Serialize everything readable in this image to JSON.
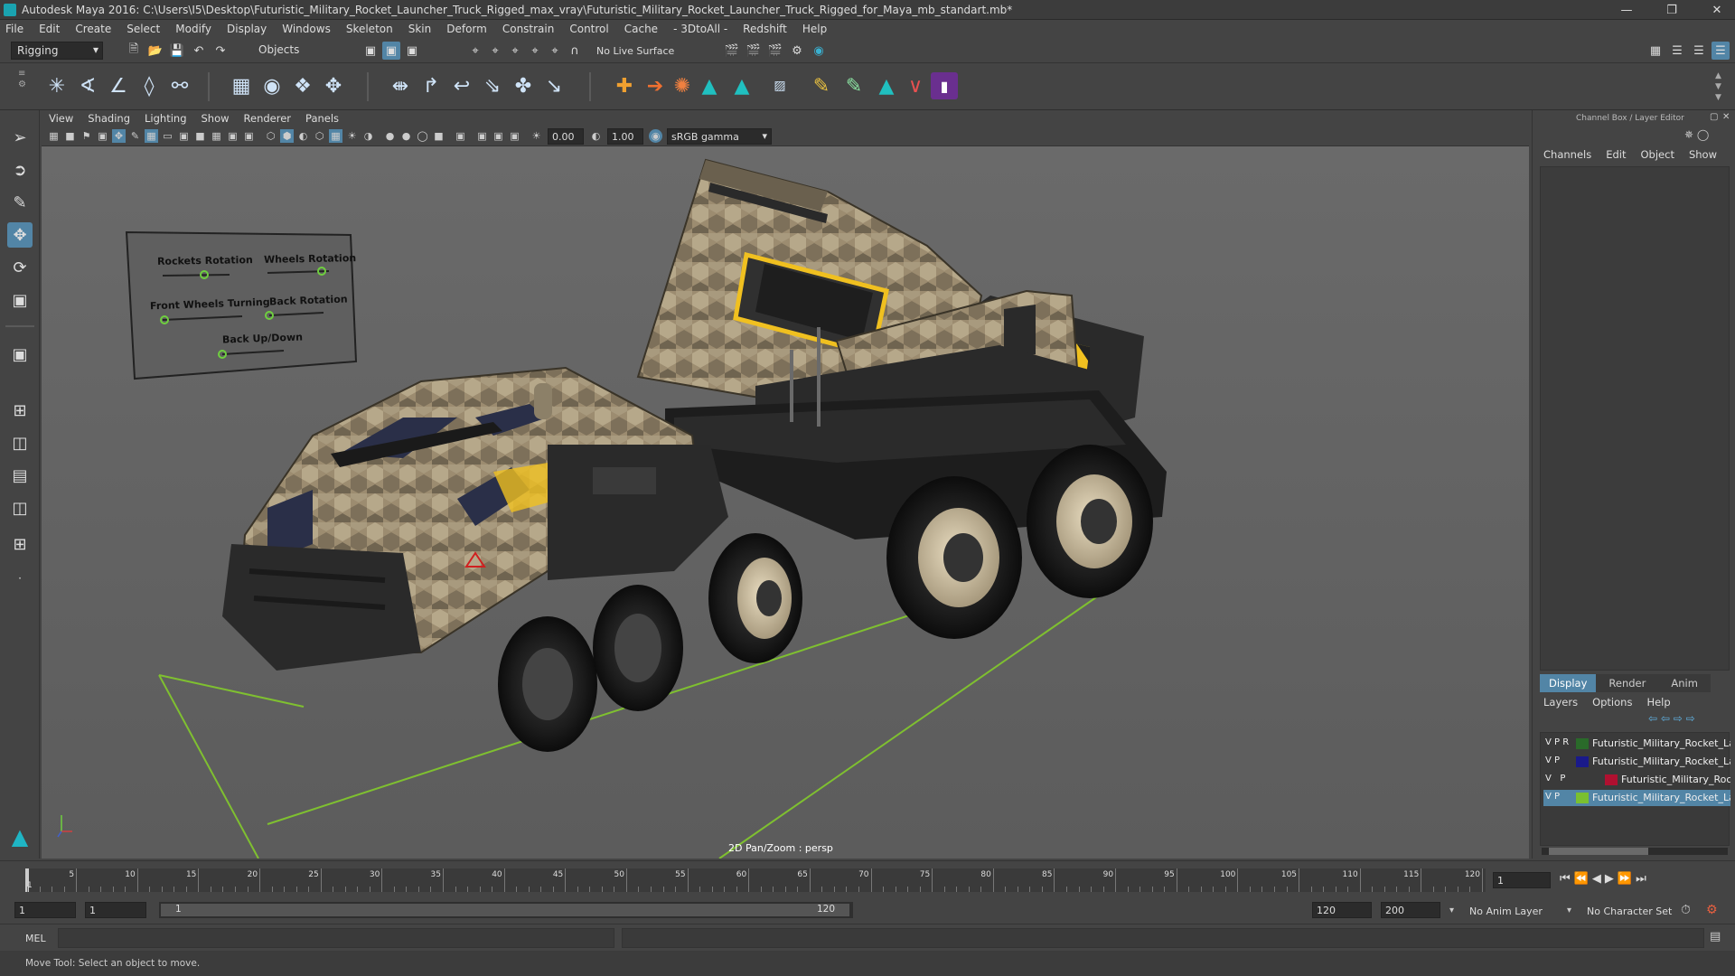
{
  "window": {
    "title": "Autodesk Maya 2016: C:\\Users\\I5\\Desktop\\Futuristic_Military_Rocket_Launcher_Truck_Rigged_max_vray\\Futuristic_Military_Rocket_Launcher_Truck_Rigged_for_Maya_mb_standart.mb*"
  },
  "menubar": {
    "items": [
      "File",
      "Edit",
      "Create",
      "Select",
      "Modify",
      "Display",
      "Windows",
      "Skeleton",
      "Skin",
      "Deform",
      "Constrain",
      "Control",
      "Cache",
      "- 3DtoAll -",
      "Redshift",
      "Help"
    ]
  },
  "statusline": {
    "menuset": "Rigging",
    "select_mode": "Objects",
    "live_surface": "No Live Surface"
  },
  "viewport": {
    "menu": [
      "View",
      "Shading",
      "Lighting",
      "Show",
      "Renderer",
      "Panels"
    ],
    "near_value": "0.00",
    "far_value": "1.00",
    "color_space": "sRGB gamma",
    "camera_label": "2D Pan/Zoom : persp",
    "control_board": {
      "labels": [
        "Rockets Rotation",
        "Wheels Rotation",
        "Front Wheels Turning",
        "Back Rotation",
        "Back Up/Down"
      ]
    }
  },
  "channelbox": {
    "title": "Channel Box / Layer Editor",
    "menu": [
      "Channels",
      "Edit",
      "Object",
      "Show"
    ]
  },
  "layer_editor": {
    "tabs": [
      "Display",
      "Render",
      "Anim"
    ],
    "menu": [
      "Layers",
      "Options",
      "Help"
    ],
    "layers": [
      {
        "flags": "V P R",
        "name": "Futuristic_Military_Rocket_La",
        "color": "#2a6a2a",
        "selected": false
      },
      {
        "flags": "V P",
        "name": "Futuristic_Military_Rocket_La",
        "color": "#1a1a8a",
        "selected": false
      },
      {
        "flags": "V   P",
        "name": "Futuristic_Military_Roc",
        "color": "#b01030",
        "selected": false
      },
      {
        "flags": "V P",
        "name": "Futuristic_Military_Rocket_La",
        "color": "#7ac030",
        "selected": true
      }
    ]
  },
  "timeline": {
    "ticks": [
      "5",
      "10",
      "15",
      "20",
      "25",
      "30",
      "35",
      "40",
      "45",
      "50",
      "55",
      "60",
      "65",
      "70",
      "75",
      "80",
      "85",
      "90",
      "95",
      "100",
      "105",
      "110",
      "115",
      "120"
    ],
    "first_tick": "1",
    "current_frame": "1"
  },
  "range": {
    "start": "1",
    "start2": "1",
    "slider_start": "1",
    "slider_end": "120",
    "end": "120",
    "end2": "200",
    "anim_layer": "No Anim Layer",
    "character_set": "No Character Set"
  },
  "cmdline": {
    "lang": "MEL"
  },
  "helpline": {
    "text": "Move Tool: Select an object to move."
  },
  "colors": {
    "accent": "#5285a6",
    "camo_light": "#9c8c70",
    "camo_dark": "#6f6450",
    "hazard_yellow": "#f0c020",
    "grid_green": "#7fc030"
  }
}
